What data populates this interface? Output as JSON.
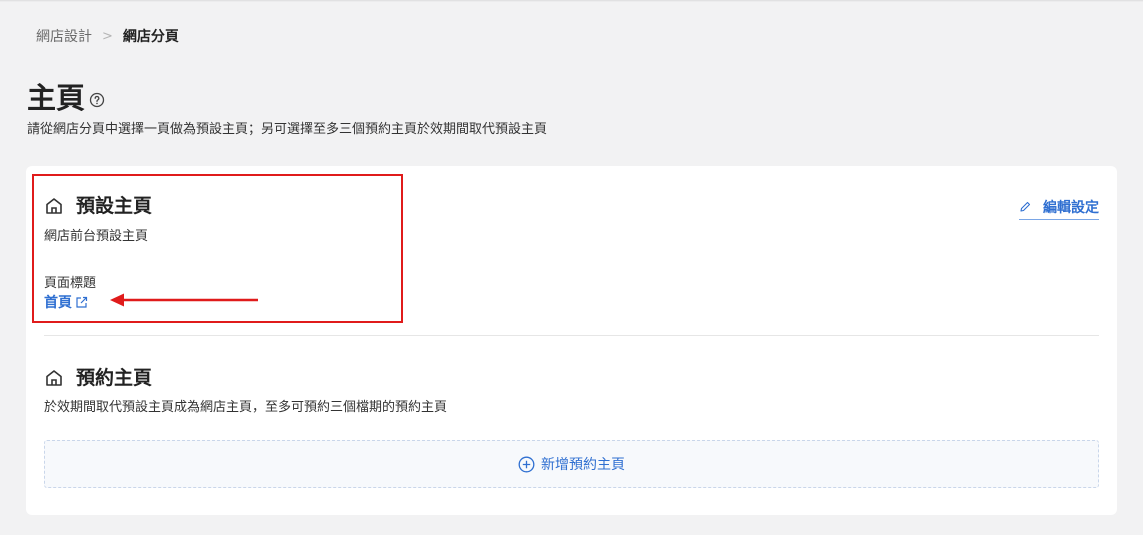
{
  "breadcrumb": {
    "parent": "網店設計",
    "separator": ">",
    "current": "網店分頁"
  },
  "page": {
    "title": "主頁",
    "description": "請從網店分頁中選擇一頁做為預設主頁；另可選擇至多三個預約主頁於效期間取代預設主頁"
  },
  "default_home": {
    "title": "預設主頁",
    "description": "網店前台預設主頁",
    "field_label": "頁面標題",
    "link_text": "首頁",
    "edit_label": "編輯設定"
  },
  "scheduled_home": {
    "title": "預約主頁",
    "description": "於效期間取代預設主頁成為網店主頁，至多可預約三個檔期的預約主頁",
    "add_label": "新增預約主頁"
  },
  "colors": {
    "accent": "#2f6fd1",
    "annotation": "#e01b1b"
  },
  "icons": [
    "help-icon",
    "home-icon",
    "pencil-icon",
    "external-link-icon",
    "plus-circle-icon"
  ]
}
